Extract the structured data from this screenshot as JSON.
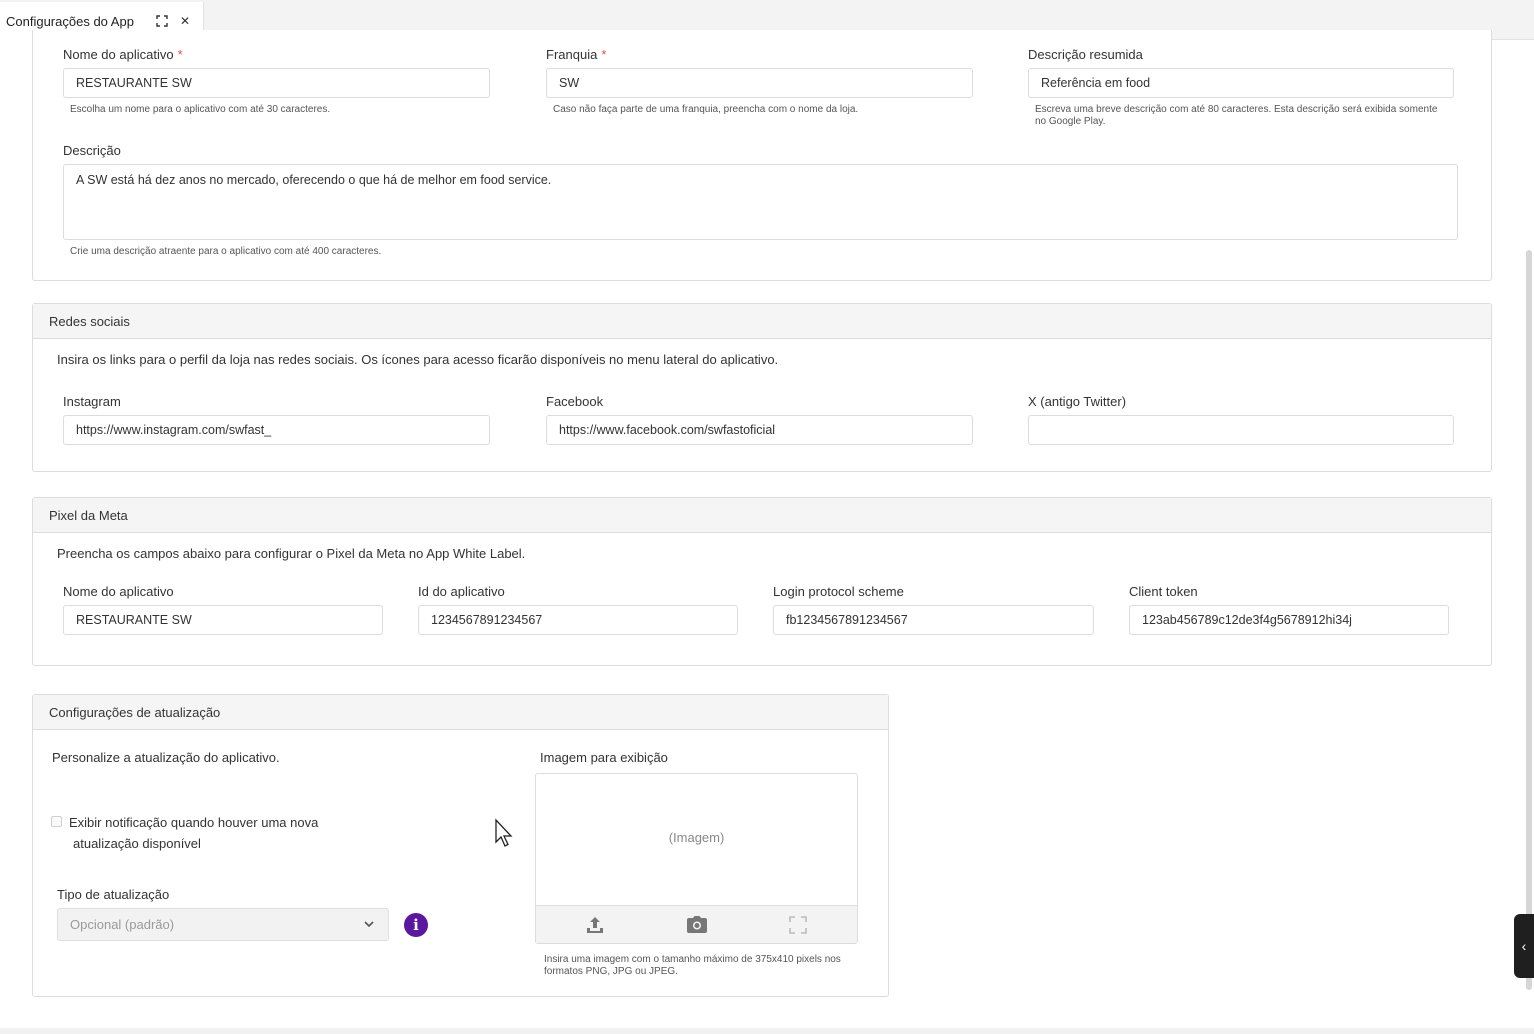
{
  "tab": {
    "title": "Configurações do App",
    "expand_icon": "expand-icon",
    "close_icon": "close-icon"
  },
  "general": {
    "app_name": {
      "label": "Nome do aplicativo",
      "required": "*",
      "value": "RESTAURANTE SW",
      "help": "Escolha um nome para o aplicativo com até 30 caracteres."
    },
    "franchise": {
      "label": "Franquia",
      "required": "*",
      "value": "SW",
      "help": "Caso não faça parte de uma franquia, preencha com o nome da loja."
    },
    "short_desc": {
      "label": "Descrição resumida",
      "value": "Referência em food",
      "help": "Escreva uma breve descrição com até 80 caracteres. Esta descrição será exibida somente no Google Play."
    },
    "description": {
      "label": "Descrição",
      "value": "A SW está há dez anos no mercado, oferecendo o que há de melhor em food service.",
      "help": "Crie uma descrição atraente para o aplicativo com até 400 caracteres."
    }
  },
  "social": {
    "title": "Redes sociais",
    "intro": "Insira os links para o perfil da loja nas redes sociais. Os ícones para acesso ficarão disponíveis no menu lateral do aplicativo.",
    "instagram": {
      "label": "Instagram",
      "value": "https://www.instagram.com/swfast_"
    },
    "facebook": {
      "label": "Facebook",
      "value": "https://www.facebook.com/swfastoficial"
    },
    "twitter": {
      "label": "X (antigo Twitter)",
      "value": ""
    }
  },
  "pixel": {
    "title": "Pixel da Meta",
    "intro": "Preencha os campos abaixo para configurar o Pixel da Meta no App White Label.",
    "app_name": {
      "label": "Nome do aplicativo",
      "value": "RESTAURANTE SW"
    },
    "app_id": {
      "label": "Id do aplicativo",
      "value": "1234567891234567"
    },
    "login_scheme": {
      "label": "Login protocol scheme",
      "value": "fb1234567891234567"
    },
    "client_token": {
      "label": "Client token",
      "value": "123ab456789c12de3f4g5678912hi34j"
    }
  },
  "update": {
    "title": "Configurações de atualização",
    "intro": "Personalize a atualização do aplicativo.",
    "notify_line1": "Exibir notificação quando houver uma nova",
    "notify_line2": "atualização disponível",
    "type_label": "Tipo de atualização",
    "type_value": "Opcional (padrão)",
    "image_label": "Imagem para exibição",
    "image_placeholder": "(Imagem)",
    "image_help": "Insira uma imagem com o tamanho máximo de 375x410 pixels nos formatos PNG, JPG ou JPEG."
  },
  "colors": {
    "accent": "#5a17a0",
    "required": "#d9534f",
    "border": "#dcdcdc"
  }
}
